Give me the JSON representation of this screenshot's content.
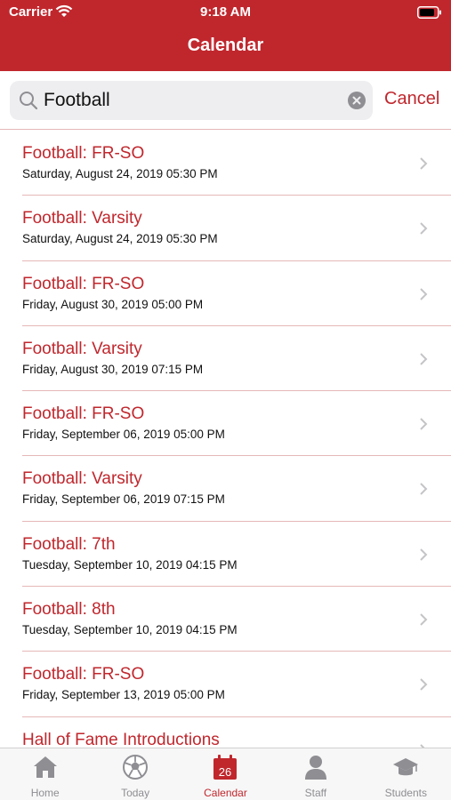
{
  "status": {
    "carrier": "Carrier",
    "time": "9:18 AM"
  },
  "header": {
    "title": "Calendar"
  },
  "search": {
    "value": "Football",
    "cancel": "Cancel"
  },
  "events": [
    {
      "title": "Football: FR-SO",
      "date": "Saturday, August 24, 2019 05:30 PM"
    },
    {
      "title": "Football: Varsity",
      "date": "Saturday, August 24, 2019 05:30 PM"
    },
    {
      "title": "Football: FR-SO",
      "date": "Friday, August 30, 2019 05:00 PM"
    },
    {
      "title": "Football: Varsity",
      "date": "Friday, August 30, 2019 07:15 PM"
    },
    {
      "title": "Football: FR-SO",
      "date": "Friday, September 06, 2019 05:00 PM"
    },
    {
      "title": "Football: Varsity",
      "date": "Friday, September 06, 2019 07:15 PM"
    },
    {
      "title": "Football: 7th",
      "date": "Tuesday, September 10, 2019 04:15 PM"
    },
    {
      "title": "Football: 8th",
      "date": "Tuesday, September 10, 2019 04:15 PM"
    },
    {
      "title": "Football: FR-SO",
      "date": "Friday, September 13, 2019 05:00 PM"
    },
    {
      "title": "Hall of Fame Introductions",
      "date": ""
    }
  ],
  "tabs": [
    {
      "label": "Home",
      "icon": "home-icon"
    },
    {
      "label": "Today",
      "icon": "soccer-ball-icon"
    },
    {
      "label": "Calendar",
      "icon": "calendar-icon",
      "badge": "26",
      "active": true
    },
    {
      "label": "Staff",
      "icon": "person-icon"
    },
    {
      "label": "Students",
      "icon": "graduation-cap-icon"
    }
  ],
  "colors": {
    "accent": "#c0272d",
    "inactive": "#8e8e93"
  }
}
